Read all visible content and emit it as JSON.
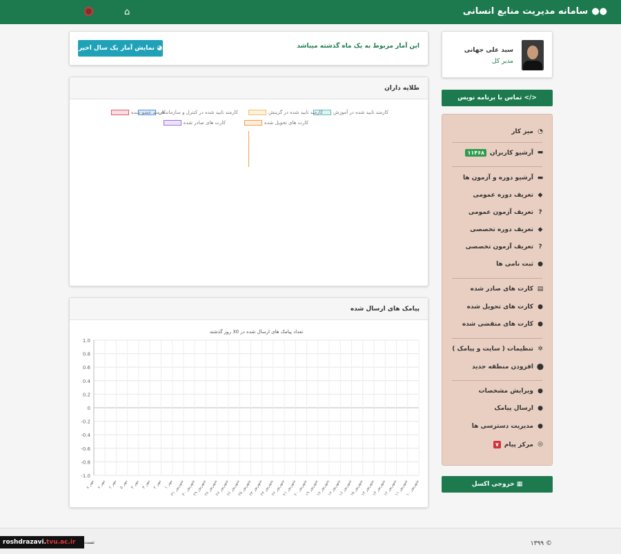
{
  "header": {
    "title": "سامانه مدیریت منابع انسانی",
    "brand_icon": "users-icon",
    "home_icon": "home-icon",
    "power_icon": "power-icon"
  },
  "profile": {
    "name": "سید علی جهانی",
    "role": "مدیر کل"
  },
  "buttons": {
    "contact": "تماس با برنامه نویس",
    "stats": "نمایش آمار یک سال اخیر",
    "excel": "خروجی اکسل"
  },
  "notice": {
    "text": "این آمار مربوط به یک ماه گذشته میباشد"
  },
  "sidebar": {
    "items": [
      {
        "label": "میز کار",
        "icon": "dashboard-icon"
      },
      {
        "label": "آرشیو کاربران",
        "icon": "archive-icon",
        "badge": "۱۱۴۶۸"
      },
      {
        "label": "آرشیو دوره و آزمون ها",
        "icon": "archive-icon"
      },
      {
        "label": "تعریف دوره عمومی",
        "icon": "book-reader-icon"
      },
      {
        "label": "تعریف آزمون عمومی",
        "icon": "question-circle-icon"
      },
      {
        "label": "تعریف دوره تخصصی",
        "icon": "book-reader-icon"
      },
      {
        "label": "تعریف آزمون تخصصی",
        "icon": "question-circle-icon"
      },
      {
        "label": "ثبت نامی ها",
        "icon": "users-icon"
      },
      {
        "label": "کارت های صادر شده",
        "icon": "id-card-icon"
      },
      {
        "label": "کارت های تحویل شده",
        "icon": "user-lock-icon"
      },
      {
        "label": "کارت های منقضی شده",
        "icon": "user-clock-icon"
      },
      {
        "label": "تنظیمات ( سایت و پیامک )",
        "icon": "gear-icon"
      },
      {
        "label": "افزودن منطقه جدید",
        "icon": "map-marker-icon"
      },
      {
        "label": "ویرایش مشخصات",
        "icon": "user-edit-icon"
      },
      {
        "label": "ارسال پیامک",
        "icon": "comment-icon"
      },
      {
        "label": "مدیریت دسترسی ها",
        "icon": "users-cog-icon"
      },
      {
        "label": "مرکز پیام",
        "icon": "globe-icon",
        "badge": "۷"
      }
    ]
  },
  "holders_panel": {
    "title": "طلایه داران",
    "legend": [
      {
        "label": "کارمند تایید شده در آموزش",
        "color": "#5bc0c0"
      },
      {
        "label": "کارمند تایید شده در گزینش",
        "color": "#f0c060"
      },
      {
        "label": "کارمند تایید شده در کنترل و سازماندهی",
        "color": "#4a90e2"
      },
      {
        "label": "کارمند عضو شده",
        "color": "#e05a6a"
      },
      {
        "label": "کارت های تحویل شده",
        "color": "#f0a050"
      },
      {
        "label": "کارت های صادر شده",
        "color": "#a070e0"
      }
    ]
  },
  "messages_panel": {
    "title": "پیامک های ارسال شده"
  },
  "chart_data": {
    "type": "line",
    "title": "تعداد پیامک های ارسال شده در 30 روز گذشته",
    "ylim": [
      -1.0,
      1.0
    ],
    "yticks": [
      "1.0",
      "0.8",
      "0.6",
      "0.4",
      "0.2",
      "0",
      "-0.2",
      "-0.4",
      "-0.6",
      "-0.8",
      "-1.0"
    ],
    "categories": [
      "۱۰ شهریور",
      "۱۱ شهریور",
      "۱۲ شهریور",
      "۱۳ شهریور",
      "۱۴ شهریور",
      "۱۵ شهریور",
      "۱۶ شهریور",
      "۱۷ شهریور",
      "۱۸ شهریور",
      "۱۹ شهریور",
      "۲۰ شهریور",
      "۲۱ شهریور",
      "۲۲ شهریور",
      "۲۳ شهریور",
      "۲۴ شهریور",
      "۲۵ شهریور",
      "۲۶ شهریور",
      "۲۷ شهریور",
      "۲۸ شهریور",
      "۲۹ شهریور",
      "۳۰ شهریور",
      "۳۱ شهریور",
      "۱ مهر",
      "۲ مهر",
      "۳ مهر",
      "۴ مهر",
      "۵ مهر",
      "۶ مهر",
      "۷ مهر",
      "۸ مهر"
    ],
    "series": [
      {
        "values": []
      }
    ],
    "grid": true
  },
  "footer": {
    "copyright": "© ۱۳۹۹",
    "watermark_a": "roshdrazavi.",
    "watermark_b": "tvu.ac.ir",
    "left_text": "تست"
  }
}
